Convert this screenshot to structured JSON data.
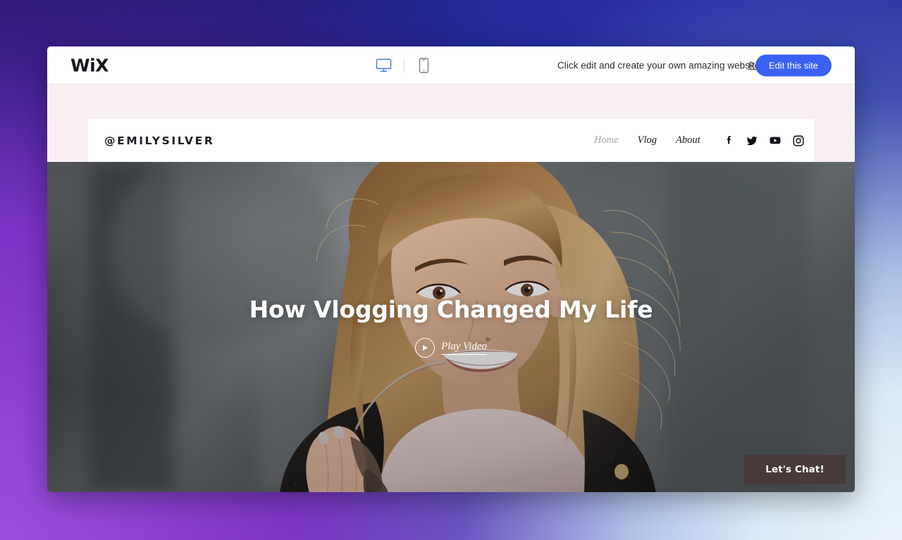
{
  "editor_bar": {
    "brand": "WiX",
    "devices": [
      {
        "name": "desktop-view-icon",
        "label": "Desktop",
        "active": true
      },
      {
        "name": "mobile-view-icon",
        "label": "Mobile",
        "active": false
      }
    ],
    "message": "Click edit and create your own amazing website",
    "read_more_label": "Read More",
    "edit_button_label": "Edit this site",
    "accent_color": "#3a61f2"
  },
  "site": {
    "band_color": "#f8eff1",
    "logo": "@EMILYSILVER",
    "nav": [
      {
        "label": "Home",
        "active": true
      },
      {
        "label": "Vlog",
        "active": false
      },
      {
        "label": "About",
        "active": false
      }
    ],
    "social": [
      {
        "icon": "facebook-icon",
        "label": "Facebook"
      },
      {
        "icon": "twitter-icon",
        "label": "Twitter"
      },
      {
        "icon": "youtube-icon",
        "label": "YouTube"
      },
      {
        "icon": "instagram-icon",
        "label": "Instagram"
      }
    ],
    "hero": {
      "title": "How Vlogging Changed My Life",
      "play_label": "Play Video",
      "chat_button_label": "Let's Chat!",
      "chat_button_color": "#493a3a"
    }
  }
}
